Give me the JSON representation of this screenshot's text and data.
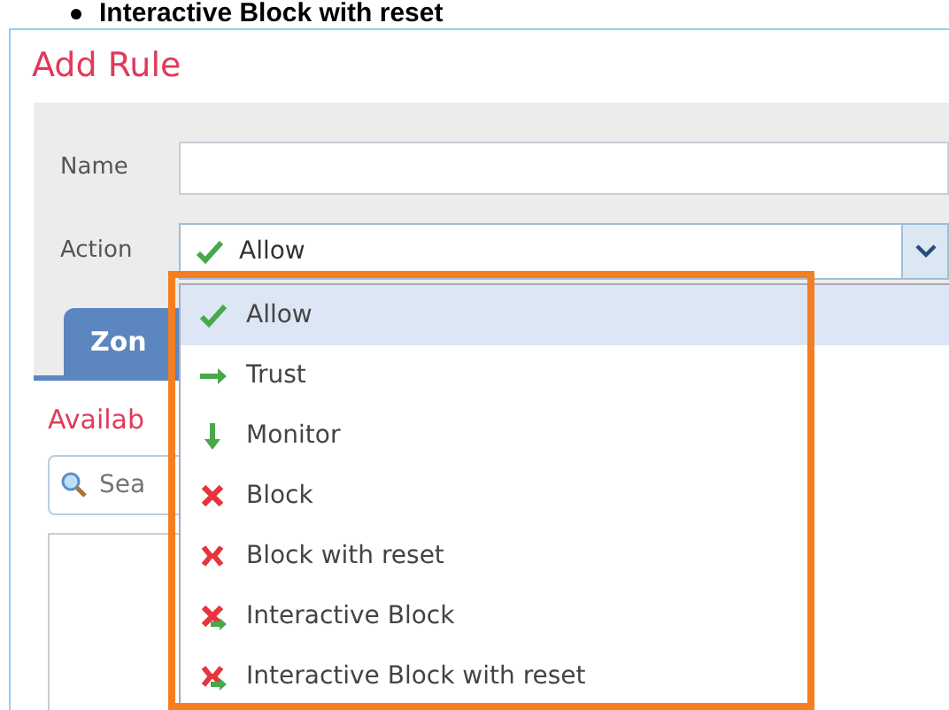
{
  "bullet_heading": "Interactive Block with reset",
  "dialog": {
    "title": "Add Rule",
    "name_field": {
      "label": "Name"
    },
    "action_field": {
      "label": "Action",
      "value": "Allow",
      "kind": "allow"
    },
    "tab": {
      "label": "Zon",
      "selected": true
    },
    "section_title": "Availab",
    "search": {
      "placeholder": "Sea"
    }
  },
  "dropdown": {
    "highlighted": true,
    "options": [
      {
        "label": "Allow",
        "kind": "allow",
        "selected": true
      },
      {
        "label": "Trust",
        "kind": "trust",
        "selected": false
      },
      {
        "label": "Monitor",
        "kind": "monitor",
        "selected": false
      },
      {
        "label": "Block",
        "kind": "block",
        "selected": false
      },
      {
        "label": "Block with reset",
        "kind": "block-reset",
        "selected": false
      },
      {
        "label": "Interactive Block",
        "kind": "interactive",
        "selected": false
      },
      {
        "label": "Interactive Block with reset",
        "kind": "interactive-reset",
        "selected": false
      }
    ]
  }
}
